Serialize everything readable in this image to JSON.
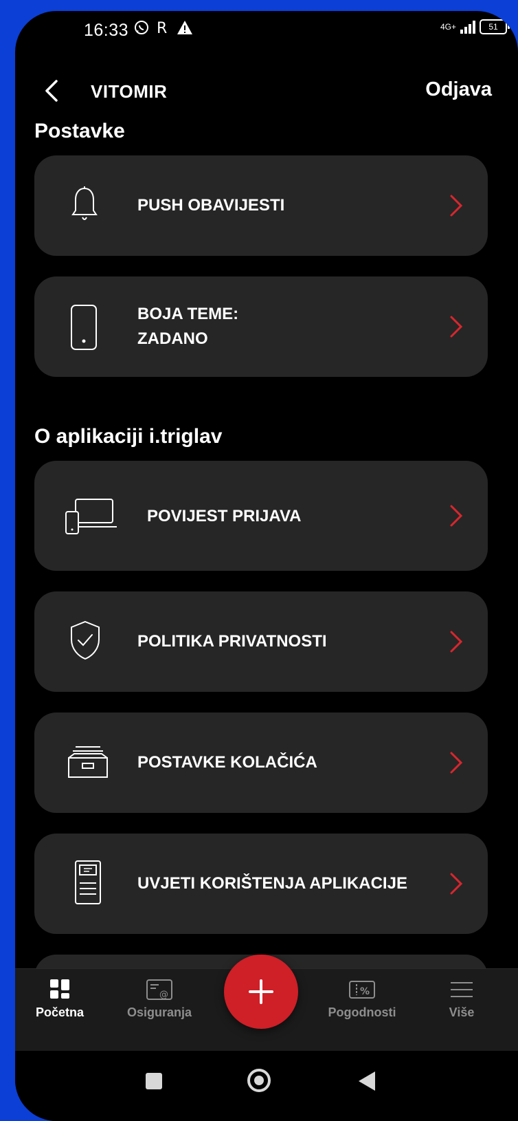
{
  "status_bar": {
    "time": "16:33",
    "network": "4G+",
    "battery": "51"
  },
  "header": {
    "user_name": "VITOMIR",
    "logout_label": "Odjava"
  },
  "settings": {
    "title": "Postavke",
    "items": [
      {
        "label": "PUSH OBAVIJESTI",
        "icon": "bell-icon"
      },
      {
        "label_line1": "BOJA TEME:",
        "label_line2": "ZADANO",
        "icon": "phone-icon"
      }
    ]
  },
  "about": {
    "title": "O aplikaciji i.triglav",
    "items": [
      {
        "label": "POVIJEST PRIJAVA",
        "icon": "devices-icon"
      },
      {
        "label": "POLITIKA PRIVATNOSTI",
        "icon": "shield-check-icon"
      },
      {
        "label": "POSTAVKE KOLAČIĆA",
        "icon": "cookie-drawer-icon"
      },
      {
        "label": "UVJETI KORIŠTENJA APLIKACIJE",
        "icon": "document-icon"
      }
    ]
  },
  "bottom_nav": {
    "items": [
      {
        "label": "Početna",
        "icon": "home-grid-icon",
        "active": true
      },
      {
        "label": "Osiguranja",
        "icon": "insurance-card-icon",
        "active": false
      },
      {
        "label": "Pogodnosti",
        "icon": "discount-ticket-icon",
        "active": false
      },
      {
        "label": "Više",
        "icon": "menu-icon",
        "active": false
      }
    ],
    "fab_icon": "plus-icon"
  },
  "colors": {
    "accent": "#cf1f27",
    "card": "#262626",
    "background": "#000000"
  }
}
